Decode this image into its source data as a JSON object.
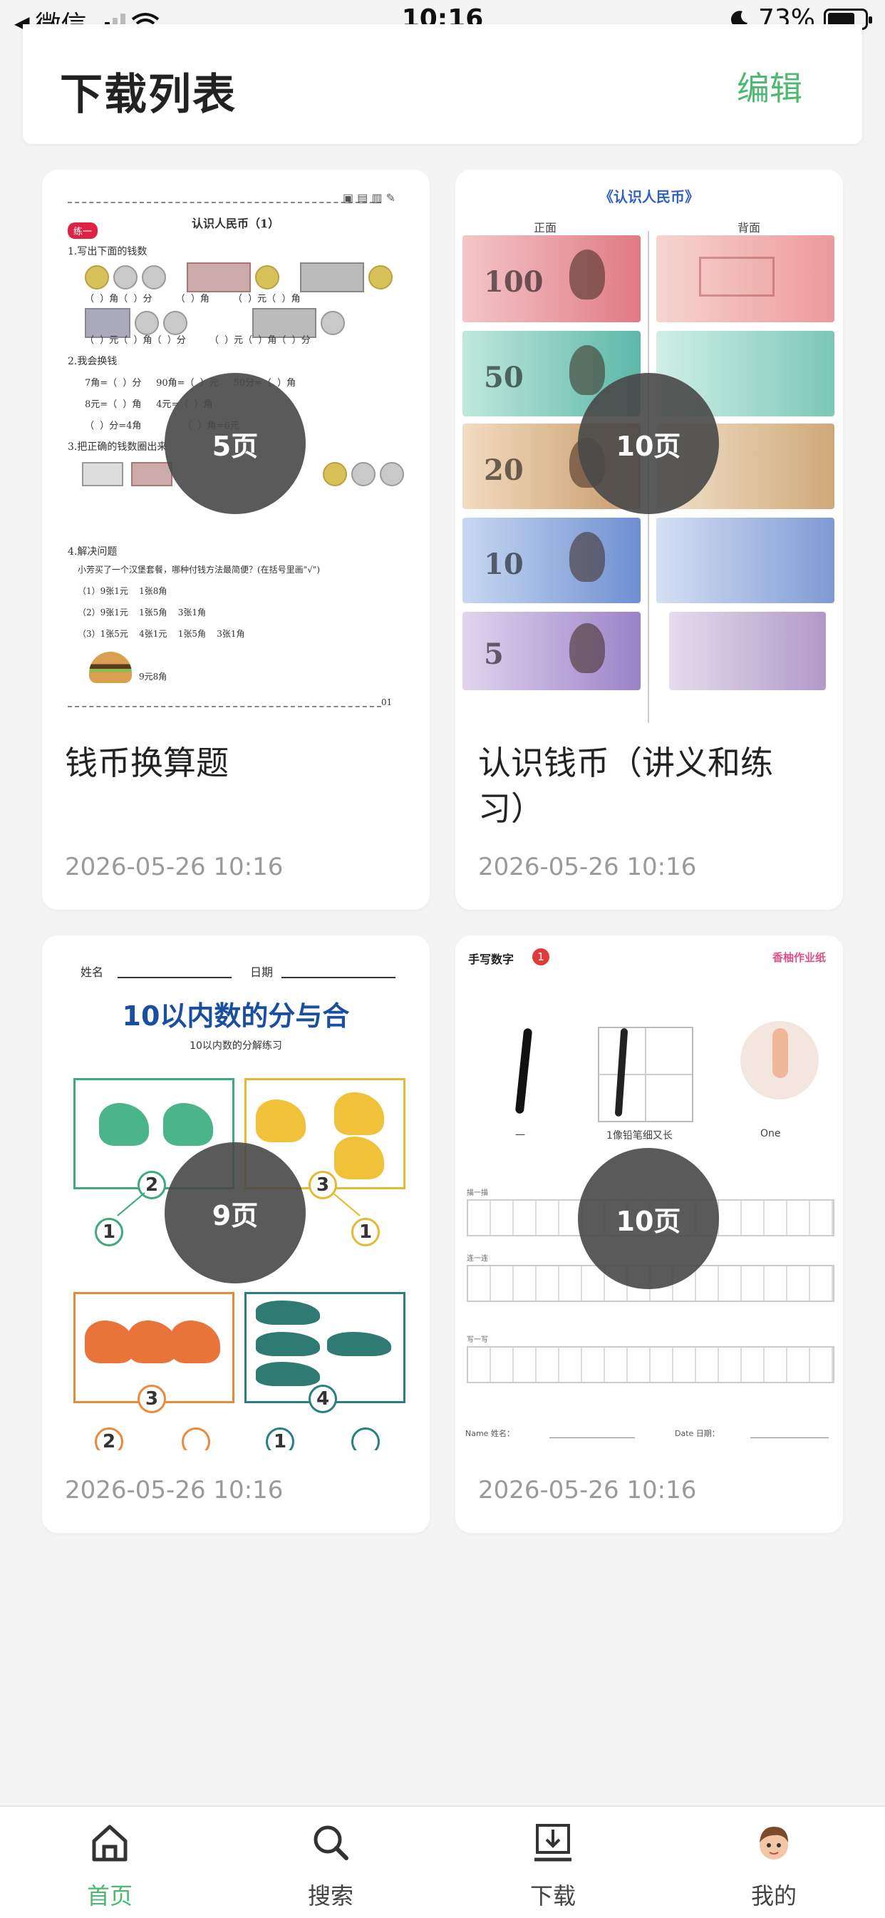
{
  "status_bar": {
    "carrier": "微信",
    "time": "10:16",
    "battery_percent": "73%",
    "battery_level": 0.73
  },
  "header": {
    "title": "下载列表",
    "edit_label": "编辑"
  },
  "items": [
    {
      "name": "钱币换算题",
      "date": "2026-05-26 10:16",
      "pages": "5页",
      "thumb": {
        "heading": "认识人民币（1）",
        "tag": "练一",
        "q1": "1.写出下面的钱数",
        "q2": "2.我会换钱",
        "q3": "3.把正确的钱数圈出来",
        "q4": "4.解决问题",
        "q4_text": "小芳买了一个汉堡套餐，哪种付钱方法最简便？(在括号里画\"√\")",
        "opt1": "（1）9张1元    1张8角",
        "opt2": "（2）9张1元    1张5角    3张1角",
        "opt3": "（3）1张5元    4张1元    1张5角    3张1角",
        "price": "9元8角",
        "row_a": "（  ）角（  ）分        （  ）角        （  ）元（  ）角",
        "row_b": "（  ）元（  ）角（  ）分        （  ）元（  ）角（  ）分",
        "ex1": "7角=（  ）分     90角=（  ）元     50分=（  ）角",
        "ex2": "8元=（  ）角     4元=（  ）角",
        "ex3": "（  ）分=4角              （  ）角=6元",
        "page_no": "01"
      }
    },
    {
      "name": "认识钱币（讲义和练习）",
      "date": "2026-05-26 10:16",
      "pages": "10页",
      "thumb": {
        "heading": "《认识人民币》",
        "front": "正面",
        "back": "背面",
        "values": [
          "100",
          "50",
          "20",
          "10",
          "5"
        ]
      }
    },
    {
      "name": "",
      "date": "2026-05-26 10:16",
      "pages": "9页",
      "thumb": {
        "name_label": "姓名",
        "date_label": "日期",
        "title": "10以内数的分与合",
        "subtitle": "10以内数的分解练习",
        "n1_top": "2",
        "n1_a": "1",
        "n2_top": "3",
        "n2_b": "1",
        "n3_top": "3",
        "n3_a": "2",
        "n4_top": "4",
        "n4_a": "1"
      }
    },
    {
      "name": "",
      "date": "2026-05-26 10:16",
      "pages": "10页",
      "thumb": {
        "title": "手写数字",
        "title_num": "1",
        "brand": "香柚作业纸",
        "caption_stroke": "一",
        "caption_rhyme": "1像铅笔细又长",
        "caption_en": "One",
        "row1": "描一描",
        "row2": "连一连",
        "row3": "写一写",
        "name_field": "Name 姓名：",
        "date_field": "Date 日期："
      }
    }
  ],
  "tabbar": [
    {
      "label": "首页",
      "icon": "home-icon",
      "active": true
    },
    {
      "label": "搜索",
      "icon": "search-icon",
      "active": false
    },
    {
      "label": "下载",
      "icon": "download-icon",
      "active": false
    },
    {
      "label": "我的",
      "icon": "avatar-icon",
      "active": false
    }
  ],
  "colors": {
    "accent": "#4db870",
    "badge": "#484848",
    "background": "#f4f4f5"
  }
}
